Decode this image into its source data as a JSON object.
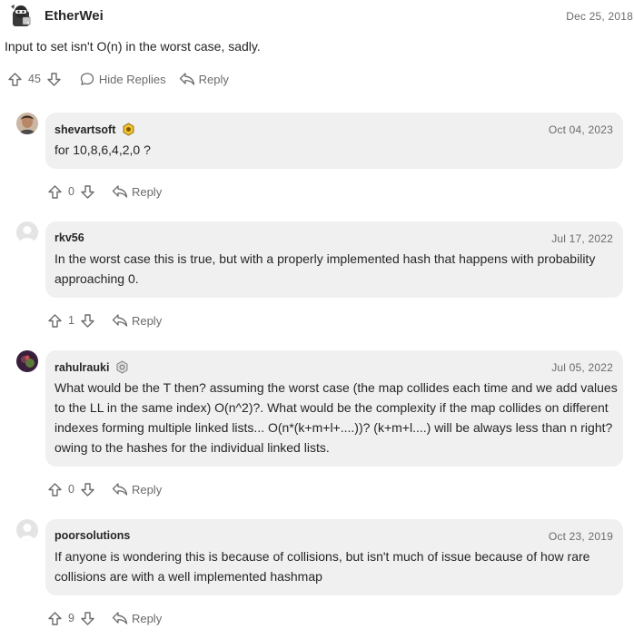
{
  "top_comment": {
    "author": "EtherWei",
    "date": "Dec 25, 2018",
    "text": "Input to set isn't O(n) in the worst case, sadly.",
    "upvotes": "45",
    "hide_replies_label": "Hide Replies",
    "reply_label": "Reply"
  },
  "replies": [
    {
      "author": "shevartsoft",
      "date": "Oct 04, 2023",
      "text": "for 10,8,6,4,2,0 ?",
      "upvotes": "0",
      "reply_label": "Reply"
    },
    {
      "author": "rkv56",
      "date": "Jul 17, 2022",
      "text": "In the worst case this is true, but with a properly implemented hash that happens with probability approaching 0.",
      "upvotes": "1",
      "reply_label": "Reply"
    },
    {
      "author": "rahulrauki",
      "date": "Jul 05, 2022",
      "text": "What would be the T then? assuming the worst case (the map collides each time and we add values to the LL in the same index) O(n^2)?. What would be the complexity if the map collides on different indexes forming multiple linked lists... O(n*(k+m+l+....))? (k+m+l....) will be always less than n right? owing to the hashes for the individual linked lists.",
      "upvotes": "0",
      "reply_label": "Reply"
    },
    {
      "author": "poorsolutions",
      "date": "Oct 23, 2019",
      "text": "If anyone is wondering this is because of collisions, but isn't much of issue because of how rare collisions are with a well implemented hashmap",
      "upvotes": "9",
      "reply_label": "Reply"
    }
  ],
  "colors": {
    "bubble_bg": "#f0f0f0",
    "muted_text": "#6b6b6b",
    "main_text": "#262626"
  }
}
